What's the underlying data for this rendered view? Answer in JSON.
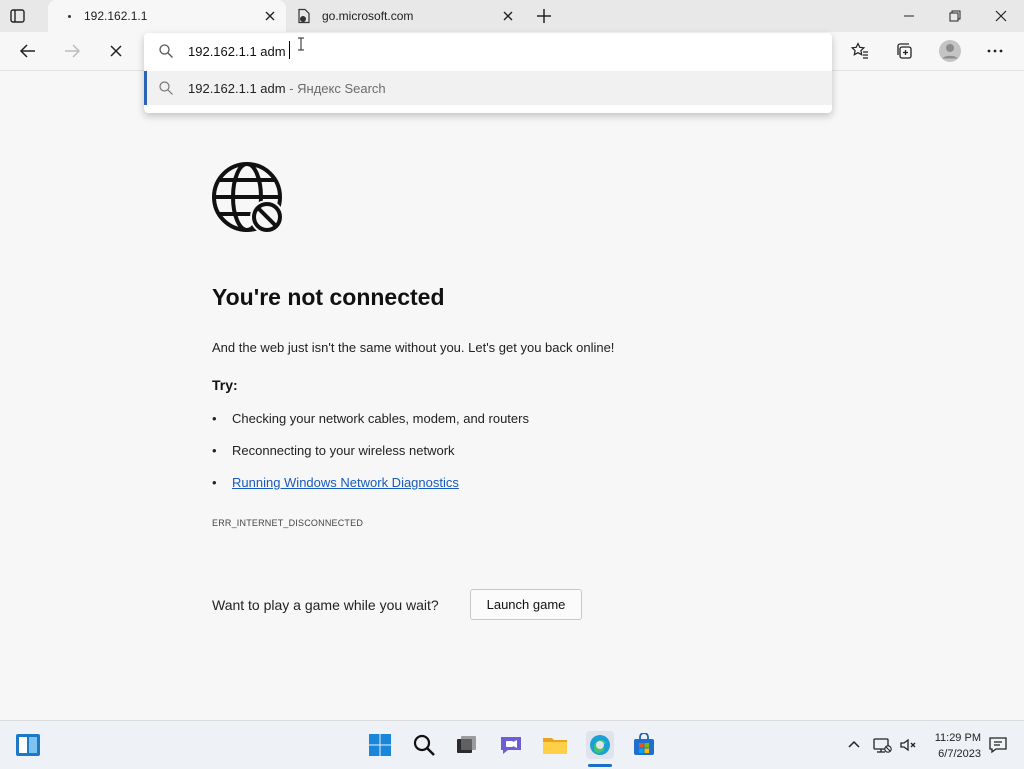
{
  "tabs": [
    {
      "title": "192.162.1.1",
      "state": "loading"
    },
    {
      "title": "go.microsoft.com"
    }
  ],
  "address_bar": {
    "value": "192.162.1.1 adm",
    "suggestion_main": "192.162.1.1 adm",
    "suggestion_sub": " - Яндекс Search"
  },
  "error_page": {
    "headline": "You're not connected",
    "body": "And the web just isn't the same without you. Let's get you back online!",
    "try_label": "Try:",
    "bullets": [
      "Checking your network cables, modem, and routers",
      "Reconnecting to your wireless network",
      "Running Windows Network Diagnostics"
    ],
    "error_code": "ERR_INTERNET_DISCONNECTED",
    "game_question": "Want to play a game while you wait?",
    "game_button": "Launch game"
  },
  "taskbar": {
    "time": "11:29 PM",
    "date": "6/7/2023"
  },
  "icons": [
    "sidebar-icon",
    "new-tab-icon",
    "minimize-icon",
    "maximize-icon",
    "close-icon",
    "back-icon",
    "forward-icon",
    "stop-icon",
    "search-icon",
    "favorites-icon",
    "collections-icon",
    "profile-icon",
    "more-icon",
    "globe-offline-icon",
    "widgets-icon",
    "start-icon",
    "taskbar-search-icon",
    "task-view-icon",
    "chat-icon",
    "file-explorer-icon",
    "edge-icon",
    "store-icon",
    "chevron-up-icon",
    "network-icon",
    "volume-icon",
    "notification-icon"
  ],
  "colors": {
    "link": "#185abd",
    "suggestion_accent": "#2b63b6"
  }
}
